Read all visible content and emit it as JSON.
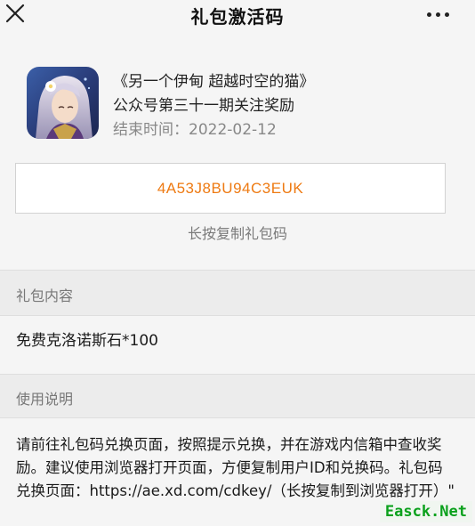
{
  "header": {
    "title": "礼包激活码"
  },
  "gift": {
    "game_title": "《另一个伊甸 超越时空的猫》",
    "subtitle": "公众号第三十一期关注奖励",
    "end_time": "结束时间：2022-02-12",
    "code": "4A53J8BU94C3EUK",
    "copy_hint": "长按复制礼包码"
  },
  "sections": {
    "contents_label": "礼包内容",
    "contents_value": "免费克洛诺斯石*100",
    "instructions_label": "使用说明",
    "instructions_text": "请前往礼包码兑换页面，按照提示兑换，并在游戏内信箱中查收奖励。建议使用浏览器打开页面，方便复制用户ID和兑换码。礼包码兑换页面：https://ae.xd.com/cdkey/（长按复制到浏览器打开）\""
  },
  "watermark": {
    "text": "Easck.Net"
  },
  "icons": {
    "close": "close-icon",
    "more": "more-icon"
  },
  "colors": {
    "code": "#ee7a12",
    "watermark": "#0aa11c"
  }
}
